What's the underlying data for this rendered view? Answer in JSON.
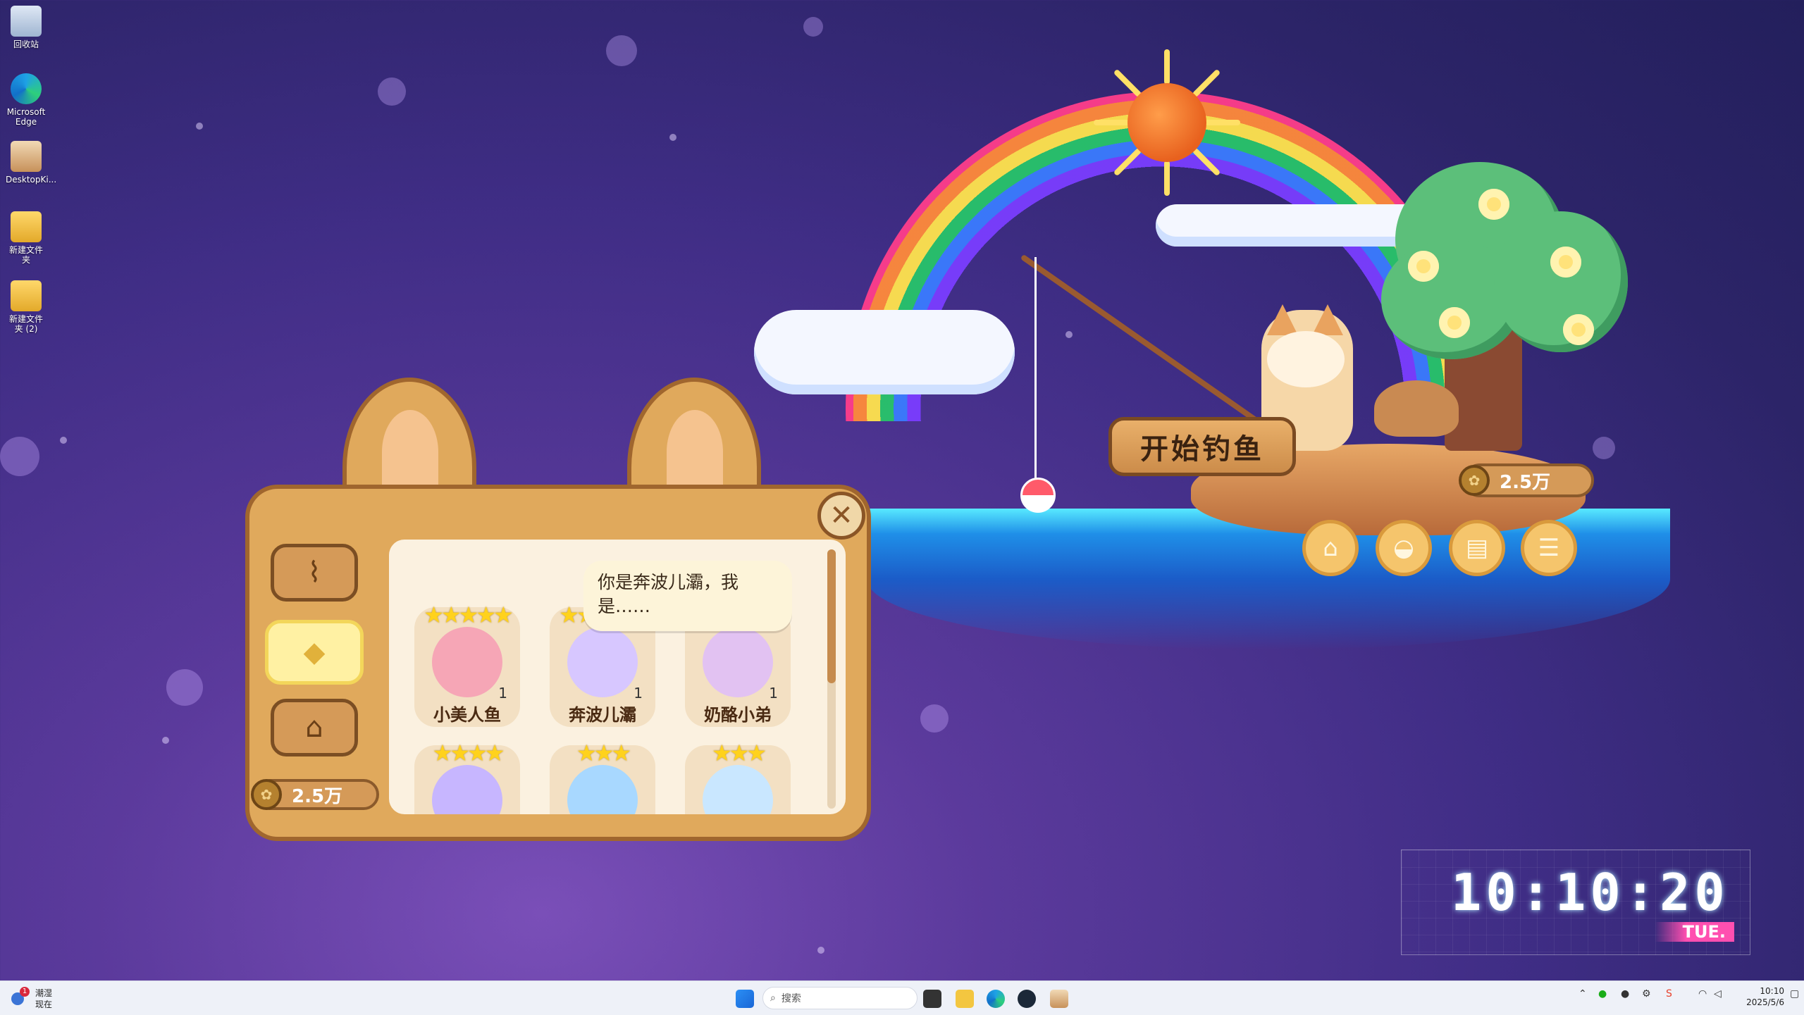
{
  "desktop": {
    "icons": [
      {
        "label": "回收站"
      },
      {
        "label": "Microsoft Edge"
      },
      {
        "label": "DesktopKi..."
      },
      {
        "label": "新建文件夹"
      },
      {
        "label": "新建文件夹 (2)"
      }
    ]
  },
  "game": {
    "start_fishing_label": "开始钓鱼",
    "coins_main": "2.5万",
    "nav_buttons": [
      {
        "icon": "home-icon"
      },
      {
        "icon": "pot-icon"
      },
      {
        "icon": "book-icon"
      },
      {
        "icon": "menu-icon"
      }
    ],
    "panel": {
      "close_label": "✕",
      "tabs": [
        {
          "icon": "hook-icon"
        },
        {
          "icon": "fish-icon"
        },
        {
          "icon": "shop-icon"
        }
      ],
      "coins": "2.5万",
      "speech_bubble": "你是奔波儿灞，我是……",
      "cards": [
        {
          "name": "小美人鱼",
          "count": "1",
          "stars": "★★★★★",
          "color": "#f6a6b6"
        },
        {
          "name": "奔波儿灞",
          "count": "1",
          "stars": "★★★★★",
          "color": "#d7c7ff"
        },
        {
          "name": "奶酪小弟",
          "count": "1",
          "stars": "★★★★",
          "color": "#e2c2f2"
        },
        {
          "name": "",
          "count": "",
          "stars": "★★★★",
          "color": "#c7b6ff"
        },
        {
          "name": "",
          "count": "",
          "stars": "★★★",
          "color": "#a8d8ff"
        },
        {
          "name": "",
          "count": "",
          "stars": "★★★",
          "color": "#c9e7ff"
        }
      ]
    }
  },
  "clock": {
    "time": "10:10:20",
    "day": "TUE."
  },
  "taskbar": {
    "notification_title": "潮湿",
    "notification_sub": "现在",
    "notification_badge": "1",
    "search_placeholder": "搜索",
    "time": "10:10",
    "date": "2025/5/6"
  }
}
